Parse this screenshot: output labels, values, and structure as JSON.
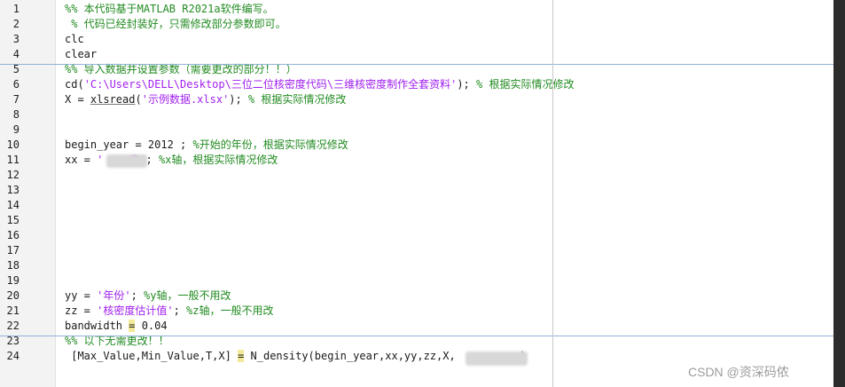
{
  "editor": {
    "lines": [
      {
        "n": "1",
        "parts": [
          {
            "t": "%% 本代码基于MATLAB R2021a软件编写。",
            "k": "c"
          }
        ]
      },
      {
        "n": "2",
        "parts": [
          {
            "t": " % 代码已经封装好，只需修改部分参数即可。",
            "k": "c"
          }
        ]
      },
      {
        "n": "3",
        "parts": [
          {
            "t": "clc",
            "k": "p"
          }
        ]
      },
      {
        "n": "4",
        "parts": [
          {
            "t": "clear",
            "k": "p"
          }
        ]
      },
      {
        "n": "5",
        "parts": [
          {
            "t": "%% 导入数据并设置参数（需要更改的部分！！）",
            "k": "c"
          }
        ]
      },
      {
        "n": "6",
        "parts": [
          {
            "t": "cd(",
            "k": "p"
          },
          {
            "t": "'C:\\Users\\DELL\\Desktop\\三位二位核密度代码\\三维核密度制作全套资料'",
            "k": "s"
          },
          {
            "t": "); ",
            "k": "p"
          },
          {
            "t": "% 根据实际情况修改",
            "k": "c"
          }
        ]
      },
      {
        "n": "7",
        "parts": [
          {
            "t": "X = ",
            "k": "p"
          },
          {
            "t": "xlsread",
            "k": "u"
          },
          {
            "t": "(",
            "k": "p"
          },
          {
            "t": "'示例数据.xlsx'",
            "k": "s"
          },
          {
            "t": "); ",
            "k": "p"
          },
          {
            "t": "% 根据实际情况修改",
            "k": "c"
          }
        ]
      },
      {
        "n": "8",
        "parts": []
      },
      {
        "n": "9",
        "parts": []
      },
      {
        "n": "10",
        "parts": [
          {
            "t": "begin_year = 2012 ; ",
            "k": "p"
          },
          {
            "t": "%开始的年份，根据实际情况修改",
            "k": "c"
          }
        ]
      },
      {
        "n": "11",
        "parts": [
          {
            "t": "xx = ",
            "k": "p"
          },
          {
            "t": "'    度'",
            "k": "s"
          },
          {
            "t": "; ",
            "k": "p"
          },
          {
            "t": "%x轴，根据实际情况修改",
            "k": "c"
          }
        ]
      },
      {
        "n": "12",
        "parts": []
      },
      {
        "n": "13",
        "parts": []
      },
      {
        "n": "14",
        "parts": []
      },
      {
        "n": "15",
        "parts": []
      },
      {
        "n": "16",
        "parts": []
      },
      {
        "n": "17",
        "parts": []
      },
      {
        "n": "18",
        "parts": []
      },
      {
        "n": "19",
        "parts": []
      },
      {
        "n": "20",
        "parts": [
          {
            "t": "yy = ",
            "k": "p"
          },
          {
            "t": "'年份'",
            "k": "s"
          },
          {
            "t": "; ",
            "k": "p"
          },
          {
            "t": "%y轴，一般不用改",
            "k": "c"
          }
        ]
      },
      {
        "n": "21",
        "parts": [
          {
            "t": "zz = ",
            "k": "p"
          },
          {
            "t": "'核密度估计值'",
            "k": "s"
          },
          {
            "t": "; ",
            "k": "p"
          },
          {
            "t": "%z轴，一般不用改",
            "k": "c"
          }
        ]
      },
      {
        "n": "22",
        "parts": [
          {
            "t": "bandwidth ",
            "k": "p"
          },
          {
            "t": "=",
            "k": "h"
          },
          {
            "t": " 0.04",
            "k": "p"
          }
        ]
      },
      {
        "n": "23",
        "parts": [
          {
            "t": "%% 以下无需更改！！",
            "k": "c"
          }
        ]
      },
      {
        "n": "24",
        "parts": [
          {
            "t": " [Max_Value,Min_Value,T,X] ",
            "k": "p"
          },
          {
            "t": "=",
            "k": "h"
          },
          {
            "t": " N_density(begin_year,xx,yy,zz,X, ",
            "k": "p"
          },
          {
            "t": "         ",
            "k": "p"
          },
          {
            "t": ")",
            "k": "p"
          }
        ]
      }
    ]
  },
  "watermark": "CSDN @资深码侬"
}
